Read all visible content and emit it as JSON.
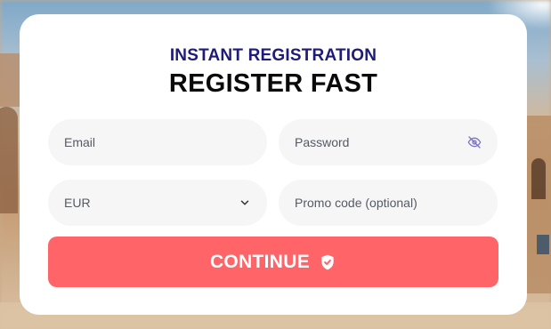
{
  "form": {
    "subtitle": "INSTANT REGISTRATION",
    "title": "REGISTER FAST",
    "email": {
      "placeholder": "Email",
      "value": ""
    },
    "password": {
      "placeholder": "Password",
      "value": "",
      "toggle_icon": "eye-off-icon"
    },
    "currency": {
      "selected": "EUR",
      "icon": "chevron-down-icon"
    },
    "promo": {
      "placeholder": "Promo code (optional)",
      "value": ""
    },
    "submit": {
      "label": "CONTINUE",
      "icon": "shield-check-icon"
    }
  },
  "colors": {
    "subtitle": "#1f1b7a",
    "title": "#0a0a0a",
    "field_background": "#f6f6f6",
    "button": "#ff6468",
    "button_text": "#ffffff",
    "eye_icon": "#7a74c9"
  }
}
